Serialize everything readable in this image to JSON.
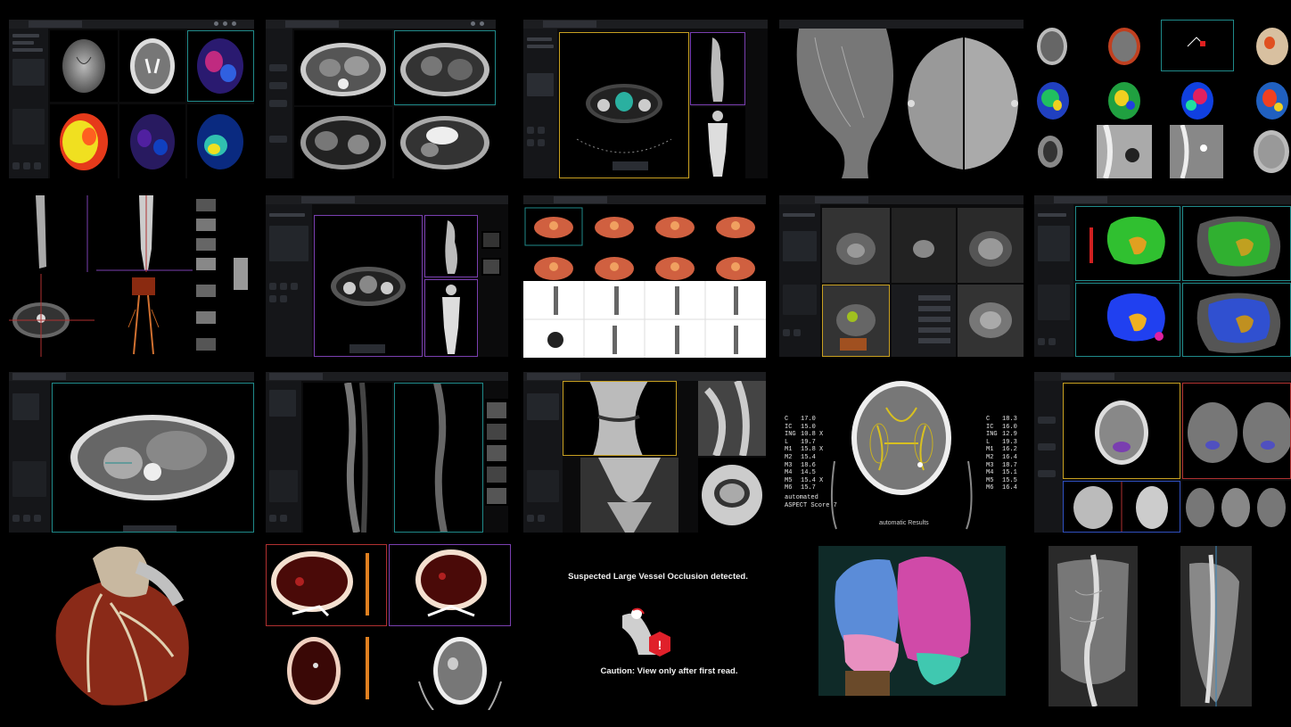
{
  "collage": {
    "background": "#000000",
    "accent_colors": {
      "teal": "#1f8a8a",
      "yellow": "#c8a020",
      "purple": "#7a3fb0",
      "red": "#b03030",
      "blue": "#3050c0"
    }
  },
  "aspect_panel": {
    "left_scores": [
      {
        "label": "C",
        "value": "17.0"
      },
      {
        "label": "IC",
        "value": "15.0"
      },
      {
        "label": "ING",
        "value": "10.8 X"
      },
      {
        "label": "L",
        "value": "19.7"
      },
      {
        "label": "M1",
        "value": "15.8 X"
      },
      {
        "label": "M2",
        "value": "15.4"
      },
      {
        "label": "M3",
        "value": "18.6"
      },
      {
        "label": "M4",
        "value": "14.5"
      },
      {
        "label": "M5",
        "value": "15.4 X"
      },
      {
        "label": "M6",
        "value": "15.7"
      }
    ],
    "right_scores": [
      {
        "label": "C",
        "value": "18.3"
      },
      {
        "label": "IC",
        "value": "16.0"
      },
      {
        "label": "ING",
        "value": "12.9"
      },
      {
        "label": "L",
        "value": "19.3"
      },
      {
        "label": "M1",
        "value": "16.2"
      },
      {
        "label": "M2",
        "value": "16.4"
      },
      {
        "label": "M3",
        "value": "18.7"
      },
      {
        "label": "M4",
        "value": "15.1"
      },
      {
        "label": "M5",
        "value": "15.5"
      },
      {
        "label": "M6",
        "value": "16.4"
      }
    ],
    "score_label_line1": "automated",
    "score_label_line2": "ASPECT Score 7",
    "results_label": "automatic Results"
  },
  "lvo_alert": {
    "title": "Suspected Large Vessel Occlusion detected.",
    "caution": "Caution: View only after first read.",
    "badge": "!",
    "badge_color": "#e0202a",
    "icon": "vessel-occlusion-icon"
  }
}
